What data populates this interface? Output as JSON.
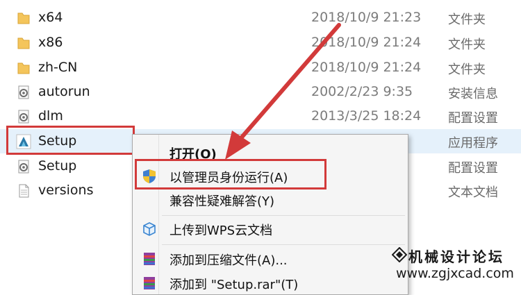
{
  "files": [
    {
      "name": "x64",
      "date": "2018/10/9 21:23",
      "type": "文件夹",
      "icon": "folder-icon"
    },
    {
      "name": "x86",
      "date": "2018/10/9 21:24",
      "type": "文件夹",
      "icon": "folder-icon"
    },
    {
      "name": "zh-CN",
      "date": "2018/10/9 21:24",
      "type": "文件夹",
      "icon": "folder-icon"
    },
    {
      "name": "autorun",
      "date": "2002/2/23 9:35",
      "type": "安装信息",
      "icon": "settings-file-icon"
    },
    {
      "name": "dlm",
      "date": "2013/3/25 18:24",
      "type": "配置设置",
      "icon": "settings-file-icon"
    },
    {
      "name": "Setup",
      "date": "",
      "type": "应用程序",
      "icon": "app-icon"
    },
    {
      "name": "Setup",
      "date": "",
      "type": "配置设置",
      "icon": "settings-file-icon"
    },
    {
      "name": "versions",
      "date": "",
      "type": "文本文档",
      "icon": "text-file-icon"
    }
  ],
  "context_menu": {
    "open": "打开(O)",
    "run_as_admin": "以管理员身份运行(A)",
    "compat": "兼容性疑难解答(Y)",
    "upload": "上传到WPS云文档",
    "add_archive": "添加到压缩文件(A)...",
    "add_named": "添加到 \"Setup.rar\"(T)"
  },
  "watermark": {
    "title": "机械设计论坛",
    "url": "www.zgjxcad.com"
  },
  "colors": {
    "highlight": "#d23a3a",
    "selection": "#e5f1fb",
    "folder": "#f4c55b"
  }
}
